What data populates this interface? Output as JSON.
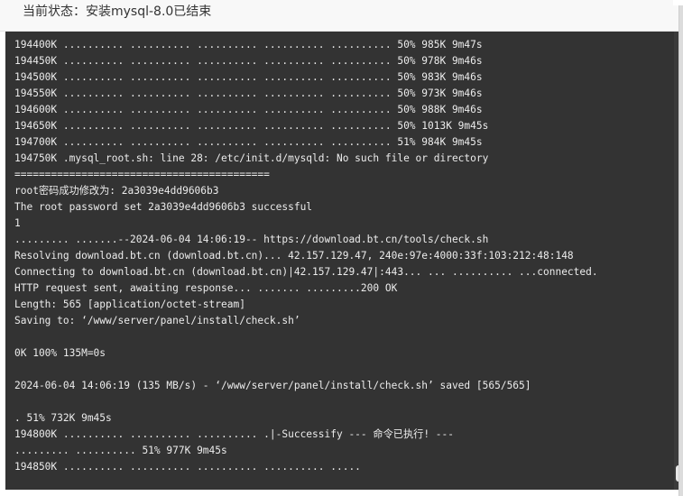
{
  "dialog": {
    "title": "当前状态：安装mysql-8.0已结束"
  },
  "console": {
    "lines": [
      "194400K .......... .......... .......... .......... .......... 50% 985K 9m47s",
      "194450K .......... .......... .......... .......... .......... 50% 978K 9m46s",
      "194500K .......... .......... .......... .......... .......... 50% 983K 9m46s",
      "194550K .......... .......... .......... .......... .......... 50% 973K 9m46s",
      "194600K .......... .......... .......... .......... .......... 50% 988K 9m46s",
      "194650K .......... .......... .......... .......... .......... 50% 1013K 9m45s",
      "194700K .......... .......... .......... .......... .......... 51% 984K 9m45s",
      "194750K .mysql_root.sh: line 28: /etc/init.d/mysqld: No such file or directory",
      "==========================================",
      "root密码成功修改为: 2a3039e4dd9606b3",
      "The root password set 2a3039e4dd9606b3 successful",
      "1",
      "......... .......--2024-06-04 14:06:19-- https://download.bt.cn/tools/check.sh",
      "Resolving download.bt.cn (download.bt.cn)... 42.157.129.47, 240e:97e:4000:33f:103:212:48:148",
      "Connecting to download.bt.cn (download.bt.cn)|42.157.129.47|:443... ... .......... ...connected.",
      "HTTP request sent, awaiting response... ....... .........200 OK",
      "Length: 565 [application/octet-stream]",
      "Saving to: ‘/www/server/panel/install/check.sh’",
      "",
      "0K 100% 135M=0s",
      "",
      "2024-06-04 14:06:19 (135 MB/s) - ‘/www/server/panel/install/check.sh’ saved [565/565]",
      "",
      ". 51% 732K 9m45s",
      "194800K .......... .......... .......... .|-Successify --- 命令已执行! ---",
      "......... .......... 51% 977K 9m45s",
      "194850K .......... .......... .......... .......... ....."
    ]
  },
  "colors": {
    "console_background": "#333333",
    "console_text": "#ececec",
    "header_background": "#f8f8f8"
  }
}
